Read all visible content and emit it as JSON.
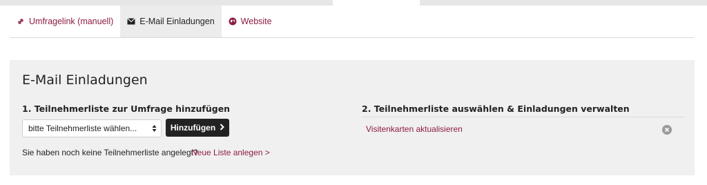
{
  "tabs": [
    {
      "label": "Umfragelink (manuell)",
      "icon": "link-icon",
      "active": false
    },
    {
      "label": "E-Mail Einladungen",
      "icon": "envelope-icon",
      "active": true
    },
    {
      "label": "Website",
      "icon": "globe-icon",
      "active": false
    }
  ],
  "panel": {
    "title": "E-Mail Einladungen",
    "step1": {
      "title": "1. Teilnehmerliste zur Umfrage hinzufügen",
      "select_value": "bitte Teilnehmerliste wählen...",
      "add_button_label": "Hinzufügen",
      "hint_text": "Sie haben noch keine Teilnehmerliste angelegt?",
      "new_list_link": "Neue Liste anlegen >"
    },
    "step2": {
      "title": "2. Teilnehmerliste auswählen & Einladungen verwalten",
      "items": [
        {
          "label": "Visitenkarten aktualisieren",
          "remove_icon": "close-circle-icon"
        }
      ]
    }
  },
  "colors": {
    "accent": "#8c1c3f",
    "panel_bg": "#f0f0f0",
    "button_bg": "#222222"
  }
}
